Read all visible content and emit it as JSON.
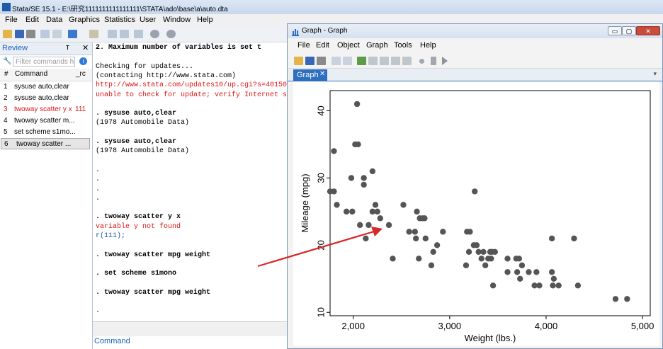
{
  "window": {
    "title": "Stata/SE 15.1 - E:\\研究1111111111111111\\STATA\\ado\\base\\a\\auto.dta"
  },
  "menu": [
    "File",
    "Edit",
    "Data",
    "Graphics",
    "Statistics",
    "User",
    "Window",
    "Help"
  ],
  "review": {
    "title": "Review",
    "pin_glyph": "ᴛ",
    "close_glyph": "✕",
    "filter_placeholder": "Filter commands he",
    "col_num": "#",
    "col_command": "Command",
    "col_rc": "_rc",
    "rows": [
      {
        "num": "1",
        "command": "sysuse auto,clear",
        "rc": "",
        "error": false
      },
      {
        "num": "2",
        "command": "sysuse auto,clear",
        "rc": "",
        "error": false
      },
      {
        "num": "3",
        "command": "twoway scatter y x",
        "rc": "111",
        "error": true
      },
      {
        "num": "4",
        "command": "twoway scatter m...",
        "rc": "",
        "error": false
      },
      {
        "num": "5",
        "command": "set scheme s1mo...",
        "rc": "",
        "error": false
      },
      {
        "num": "6",
        "command": "twoway scatter ...",
        "rc": "",
        "error": false
      }
    ]
  },
  "results": {
    "lines": [
      {
        "text": "     2.  Maximum number of variables is set t",
        "style": "bold"
      },
      {
        "text": "",
        "style": ""
      },
      {
        "text": "Checking for updates...",
        "style": ""
      },
      {
        "text": "(contacting http://www.stata.com)",
        "style": ""
      },
      {
        "text": "http://www.stata.com/updates10/up.cgi?s=401506",
        "style": "err"
      },
      {
        "text": "unable to check for update; verify Internet se",
        "style": "err"
      },
      {
        "text": "",
        "style": ""
      },
      {
        "text": ". sysuse auto,clear",
        "style": "bold"
      },
      {
        "text": "(1978 Automobile Data)",
        "style": ""
      },
      {
        "text": "",
        "style": ""
      },
      {
        "text": ". sysuse auto,clear",
        "style": "bold"
      },
      {
        "text": "(1978 Automobile Data)",
        "style": ""
      },
      {
        "text": "",
        "style": ""
      },
      {
        "text": ".",
        "style": ""
      },
      {
        "text": ".",
        "style": ""
      },
      {
        "text": ".",
        "style": ""
      },
      {
        "text": ".",
        "style": ""
      },
      {
        "text": "",
        "style": ""
      },
      {
        "text": ". twoway scatter y x",
        "style": "bold"
      },
      {
        "text": "variable y not found",
        "style": "err"
      },
      {
        "text": "r(111);",
        "style": "lnk"
      },
      {
        "text": "",
        "style": ""
      },
      {
        "text": ". twoway scatter mpg weight",
        "style": "bold"
      },
      {
        "text": "",
        "style": ""
      },
      {
        "text": ". set scheme s1mono",
        "style": "bold"
      },
      {
        "text": "",
        "style": ""
      },
      {
        "text": ".  twoway scatter mpg weight",
        "style": "bold"
      },
      {
        "text": "",
        "style": ""
      },
      {
        "text": ".",
        "style": ""
      }
    ]
  },
  "command": {
    "label": "Command"
  },
  "graph_window": {
    "title": "Graph - Graph",
    "min_glyph": "▭",
    "max_glyph": "▢",
    "close_glyph": "✕",
    "menu": [
      "File",
      "Edit",
      "Object",
      "Graph",
      "Tools",
      "Help"
    ],
    "tab_label": "Graph",
    "tab_close": "✕",
    "dropdown_glyph": "▾"
  },
  "chart_data": {
    "type": "scatter",
    "title": "",
    "xlabel": "Weight (lbs.)",
    "ylabel": "Mileage (mpg)",
    "xlim": [
      1760,
      5080
    ],
    "ylim": [
      9.5,
      43
    ],
    "xticks": [
      2000,
      3000,
      4000,
      5000
    ],
    "xtick_labels": [
      "2,000",
      "3,000",
      "4,000",
      "5,000"
    ],
    "yticks": [
      10,
      20,
      30,
      40
    ],
    "ytick_labels": [
      "10",
      "20",
      "30",
      "40"
    ],
    "grid": false,
    "marker_color": "#555555",
    "points": [
      [
        2040,
        41
      ],
      [
        1800,
        34
      ],
      [
        2020,
        35
      ],
      [
        2050,
        35
      ],
      [
        1760,
        28
      ],
      [
        1800,
        28
      ],
      [
        1830,
        26
      ],
      [
        1930,
        25
      ],
      [
        1990,
        25
      ],
      [
        1980,
        30
      ],
      [
        2110,
        30
      ],
      [
        2110,
        29
      ],
      [
        2200,
        31
      ],
      [
        2070,
        23
      ],
      [
        2130,
        21
      ],
      [
        2160,
        23
      ],
      [
        2200,
        25
      ],
      [
        2230,
        26
      ],
      [
        2250,
        25
      ],
      [
        2280,
        24
      ],
      [
        2370,
        23
      ],
      [
        2410,
        18
      ],
      [
        2520,
        26
      ],
      [
        2580,
        22
      ],
      [
        2640,
        22
      ],
      [
        2650,
        21
      ],
      [
        2660,
        25
      ],
      [
        2690,
        24
      ],
      [
        2720,
        24
      ],
      [
        2740,
        24
      ],
      [
        2750,
        21
      ],
      [
        2680,
        18
      ],
      [
        2830,
        19
      ],
      [
        2810,
        17
      ],
      [
        2870,
        20
      ],
      [
        2930,
        22
      ],
      [
        3170,
        17
      ],
      [
        3180,
        22
      ],
      [
        3210,
        22
      ],
      [
        3200,
        19
      ],
      [
        3250,
        20
      ],
      [
        3260,
        28
      ],
      [
        3280,
        20
      ],
      [
        3300,
        19
      ],
      [
        3330,
        18
      ],
      [
        3350,
        19
      ],
      [
        3370,
        17
      ],
      [
        3400,
        18
      ],
      [
        3420,
        19
      ],
      [
        3430,
        18
      ],
      [
        3440,
        19
      ],
      [
        3470,
        19
      ],
      [
        3450,
        14
      ],
      [
        3600,
        18
      ],
      [
        3600,
        16
      ],
      [
        3690,
        18
      ],
      [
        3700,
        16
      ],
      [
        3720,
        18
      ],
      [
        3730,
        15
      ],
      [
        3750,
        17
      ],
      [
        3820,
        16
      ],
      [
        3880,
        14
      ],
      [
        3900,
        16
      ],
      [
        3930,
        14
      ],
      [
        4060,
        16
      ],
      [
        4070,
        14
      ],
      [
        4080,
        15
      ],
      [
        4060,
        21
      ],
      [
        4130,
        14
      ],
      [
        4290,
        21
      ],
      [
        4330,
        14
      ],
      [
        4720,
        12
      ],
      [
        4840,
        12
      ]
    ]
  }
}
